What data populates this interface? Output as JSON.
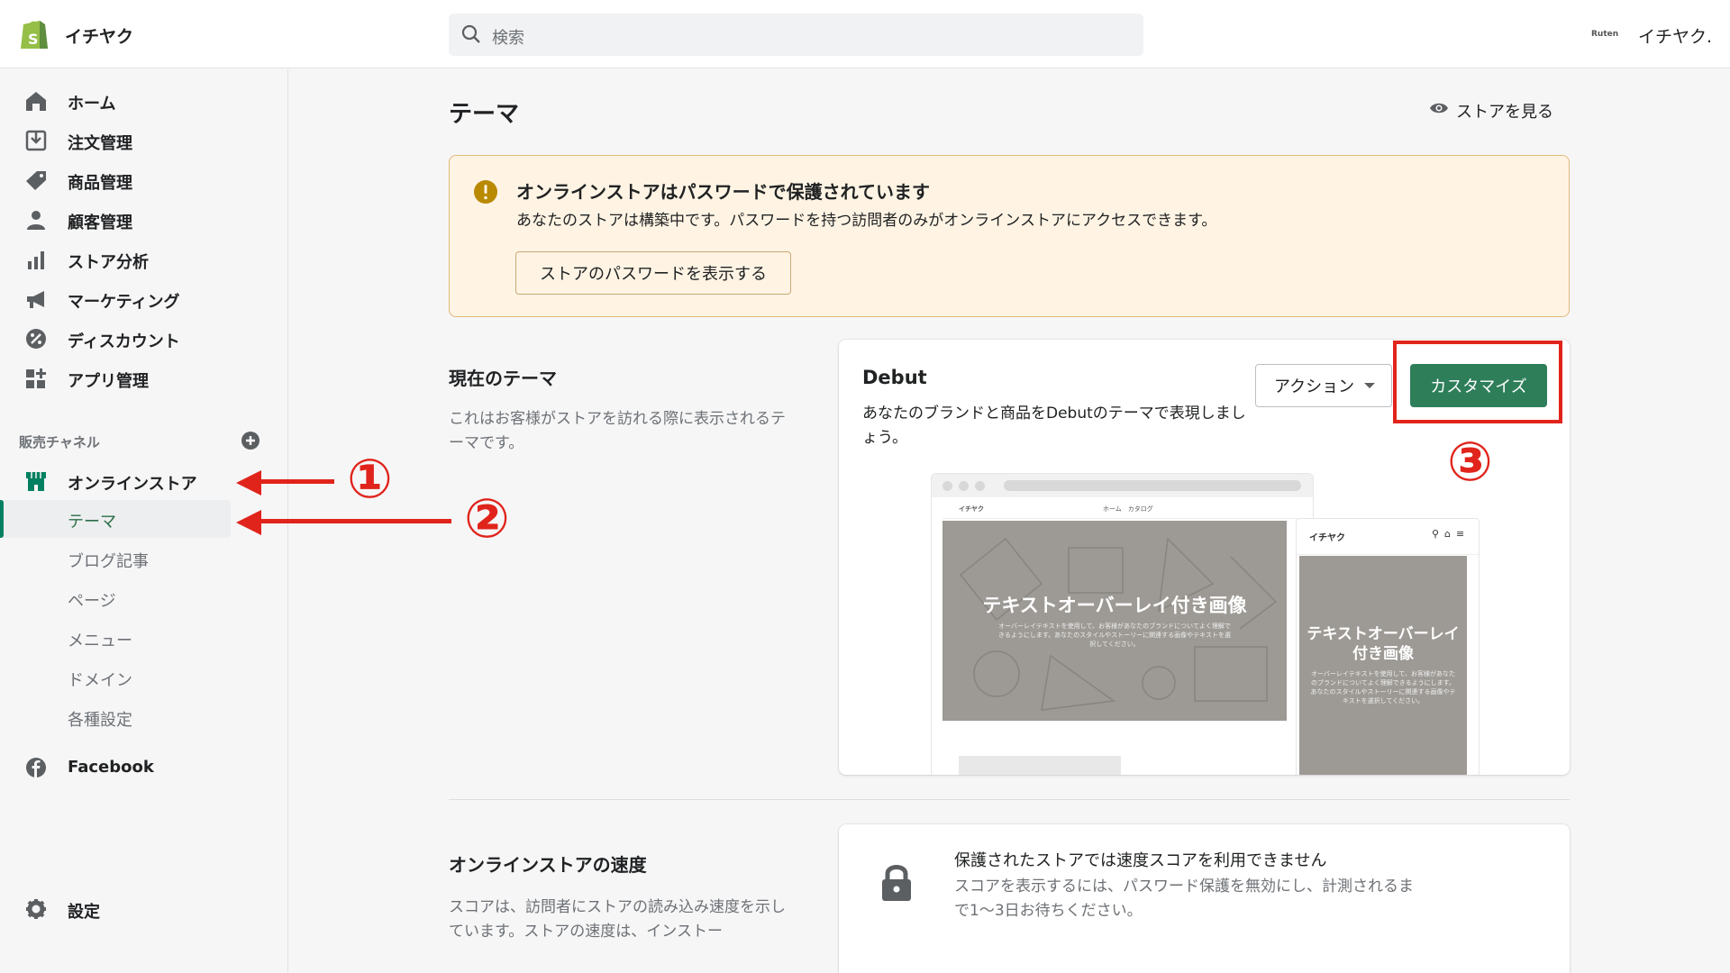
{
  "header": {
    "store_name": "イチヤク",
    "search_placeholder": "検索",
    "account_logo_text": "Ruten",
    "account_name": "イチヤク."
  },
  "sidebar": {
    "items": [
      {
        "label": "ホーム",
        "icon": "home-icon"
      },
      {
        "label": "注文管理",
        "icon": "orders-icon"
      },
      {
        "label": "商品管理",
        "icon": "tag-icon"
      },
      {
        "label": "顧客管理",
        "icon": "person-icon"
      },
      {
        "label": "ストア分析",
        "icon": "bar-chart-icon"
      },
      {
        "label": "マーケティング",
        "icon": "megaphone-icon"
      },
      {
        "label": "ディスカウント",
        "icon": "discount-icon"
      },
      {
        "label": "アプリ管理",
        "icon": "apps-icon"
      }
    ],
    "sales_channels_label": "販売チャネル",
    "online_store_label": "オンラインストア",
    "sub_items": [
      "テーマ",
      "ブログ記事",
      "ページ",
      "メニュー",
      "ドメイン",
      "各種設定"
    ],
    "active_sub_item": "テーマ",
    "facebook_label": "Facebook",
    "settings_label": "設定"
  },
  "main": {
    "page_title": "テーマ",
    "view_store_label": "ストアを見る",
    "banner": {
      "title": "オンラインストアはパスワードで保護されています",
      "text": "あなたのストアは構築中です。パスワードを持つ訪問者のみがオンラインストアにアクセスできます。",
      "button_label": "ストアのパスワードを表示する"
    },
    "current_theme": {
      "section_title": "現在のテーマ",
      "section_desc": "これはお客様がストアを訪れる際に表示されるテーマです。",
      "theme_name": "Debut",
      "theme_desc": "あなたのブランドと商品をDebutのテーマで表現しましょう。",
      "action_label": "アクション",
      "customize_label": "カスタマイズ",
      "preview": {
        "desktop_store_name": "イチヤク",
        "desktop_nav_links": "ホーム　カタログ",
        "hero_title": "テキストオーバーレイ付き画像",
        "hero_subtitle": "オーバーレイテキストを使用して、お客様があなたのブランドについてよく理解できるようにします。あなたのスタイルやストーリーに関連する画像やテキストを選択してください。",
        "mobile_store_name": "イチヤク",
        "mobile_hero_title": "テキストオーバーレイ付き画像"
      }
    },
    "speed": {
      "section_title": "オンラインストアの速度",
      "section_desc": "スコアは、訪問者にストアの読み込み速度を示しています。ストアの速度は、インストー",
      "card_title": "保護されたストアでは速度スコアを利用できません",
      "card_text": "スコアを表示するには、パスワード保護を無効にし、計測されるまで1〜3日お待ちください。"
    }
  },
  "annotations": {
    "marker_1": "①",
    "marker_2": "②",
    "marker_3": "③",
    "color": "#e0241b"
  },
  "colors": {
    "brand_green": "#2e7e5a",
    "banner_bg": "#fff4e4",
    "warning": "#b98900"
  }
}
